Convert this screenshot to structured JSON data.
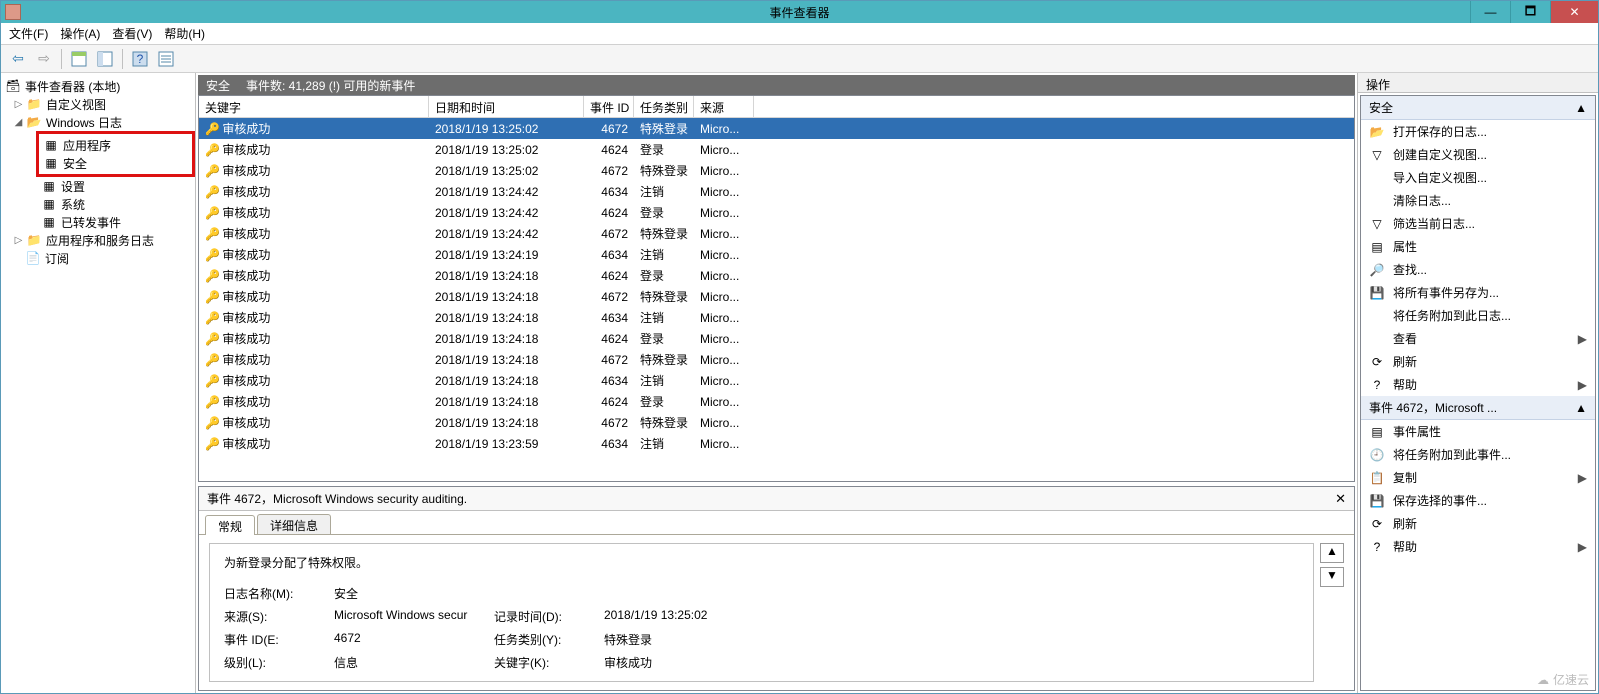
{
  "window": {
    "title": "事件查看器",
    "min": "—",
    "max": "🗖",
    "close": "✕"
  },
  "menu": {
    "file": "文件(F)",
    "action": "操作(A)",
    "view": "查看(V)",
    "help": "帮助(H)"
  },
  "tree": {
    "root": "事件查看器 (本地)",
    "custom_views": "自定义视图",
    "windows_logs": "Windows 日志",
    "application": "应用程序",
    "security": "安全",
    "setup": "设置",
    "system": "系统",
    "forwarded": "已转发事件",
    "app_svc_logs": "应用程序和服务日志",
    "subscriptions": "订阅"
  },
  "center": {
    "title": "安全",
    "count_label": "事件数: 41,289 (!) 可用的新事件"
  },
  "columns": {
    "keyword": "关键字",
    "datetime": "日期和时间",
    "event_id": "事件 ID",
    "task_cat": "任务类别",
    "source": "来源"
  },
  "events": [
    {
      "kw": "审核成功",
      "dt": "2018/1/19 13:25:02",
      "id": "4672",
      "cat": "特殊登录",
      "src": "Micro..."
    },
    {
      "kw": "审核成功",
      "dt": "2018/1/19 13:25:02",
      "id": "4624",
      "cat": "登录",
      "src": "Micro..."
    },
    {
      "kw": "审核成功",
      "dt": "2018/1/19 13:25:02",
      "id": "4672",
      "cat": "特殊登录",
      "src": "Micro..."
    },
    {
      "kw": "审核成功",
      "dt": "2018/1/19 13:24:42",
      "id": "4634",
      "cat": "注销",
      "src": "Micro..."
    },
    {
      "kw": "审核成功",
      "dt": "2018/1/19 13:24:42",
      "id": "4624",
      "cat": "登录",
      "src": "Micro..."
    },
    {
      "kw": "审核成功",
      "dt": "2018/1/19 13:24:42",
      "id": "4672",
      "cat": "特殊登录",
      "src": "Micro..."
    },
    {
      "kw": "审核成功",
      "dt": "2018/1/19 13:24:19",
      "id": "4634",
      "cat": "注销",
      "src": "Micro..."
    },
    {
      "kw": "审核成功",
      "dt": "2018/1/19 13:24:18",
      "id": "4624",
      "cat": "登录",
      "src": "Micro..."
    },
    {
      "kw": "审核成功",
      "dt": "2018/1/19 13:24:18",
      "id": "4672",
      "cat": "特殊登录",
      "src": "Micro..."
    },
    {
      "kw": "审核成功",
      "dt": "2018/1/19 13:24:18",
      "id": "4634",
      "cat": "注销",
      "src": "Micro..."
    },
    {
      "kw": "审核成功",
      "dt": "2018/1/19 13:24:18",
      "id": "4624",
      "cat": "登录",
      "src": "Micro..."
    },
    {
      "kw": "审核成功",
      "dt": "2018/1/19 13:24:18",
      "id": "4672",
      "cat": "特殊登录",
      "src": "Micro..."
    },
    {
      "kw": "审核成功",
      "dt": "2018/1/19 13:24:18",
      "id": "4634",
      "cat": "注销",
      "src": "Micro..."
    },
    {
      "kw": "审核成功",
      "dt": "2018/1/19 13:24:18",
      "id": "4624",
      "cat": "登录",
      "src": "Micro..."
    },
    {
      "kw": "审核成功",
      "dt": "2018/1/19 13:24:18",
      "id": "4672",
      "cat": "特殊登录",
      "src": "Micro..."
    },
    {
      "kw": "审核成功",
      "dt": "2018/1/19 13:23:59",
      "id": "4634",
      "cat": "注销",
      "src": "Micro..."
    }
  ],
  "detail": {
    "header": "事件 4672，Microsoft Windows security auditing.",
    "tab_general": "常规",
    "tab_details": "详细信息",
    "message": "为新登录分配了特殊权限。",
    "labels": {
      "log_name": "日志名称(M):",
      "source": "来源(S):",
      "event_id": "事件 ID(E:",
      "level": "级别(L):",
      "logged": "记录时间(D):",
      "task_cat": "任务类别(Y):",
      "keywords": "关键字(K):"
    },
    "values": {
      "log_name": "安全",
      "source": "Microsoft Windows secur",
      "event_id": "4672",
      "level": "信息",
      "logged": "2018/1/19 13:25:02",
      "task_cat": "特殊登录",
      "keywords": "审核成功"
    }
  },
  "actions": {
    "pane_title": "操作",
    "group1": "安全",
    "items1": [
      {
        "icon": "folder-open-icon",
        "glyph": "📂",
        "text": "打开保存的日志..."
      },
      {
        "icon": "filter-icon",
        "glyph": "▽",
        "text": "创建自定义视图..."
      },
      {
        "icon": "blank-icon",
        "glyph": "",
        "text": "导入自定义视图..."
      },
      {
        "icon": "blank-icon",
        "glyph": "",
        "text": "清除日志..."
      },
      {
        "icon": "filter-icon",
        "glyph": "▽",
        "text": "筛选当前日志..."
      },
      {
        "icon": "properties-icon",
        "glyph": "▤",
        "text": "属性"
      },
      {
        "icon": "find-icon",
        "glyph": "🔎",
        "text": "查找..."
      },
      {
        "icon": "save-icon",
        "glyph": "💾",
        "text": "将所有事件另存为..."
      },
      {
        "icon": "blank-icon",
        "glyph": "",
        "text": "将任务附加到此日志..."
      },
      {
        "icon": "blank-icon",
        "glyph": "",
        "text": "查看",
        "arrow": true
      },
      {
        "icon": "refresh-icon",
        "glyph": "⟳",
        "text": "刷新"
      },
      {
        "icon": "help-icon",
        "glyph": "?",
        "text": "帮助",
        "arrow": true
      }
    ],
    "group2": "事件 4672，Microsoft ...",
    "items2": [
      {
        "icon": "properties-icon",
        "glyph": "▤",
        "text": "事件属性"
      },
      {
        "icon": "attach-icon",
        "glyph": "🕘",
        "text": "将任务附加到此事件..."
      },
      {
        "icon": "copy-icon",
        "glyph": "📋",
        "text": "复制",
        "arrow": true
      },
      {
        "icon": "save-icon",
        "glyph": "💾",
        "text": "保存选择的事件..."
      },
      {
        "icon": "refresh-icon",
        "glyph": "⟳",
        "text": "刷新"
      },
      {
        "icon": "help-icon",
        "glyph": "?",
        "text": "帮助",
        "arrow": true
      }
    ]
  },
  "watermark": "亿速云"
}
